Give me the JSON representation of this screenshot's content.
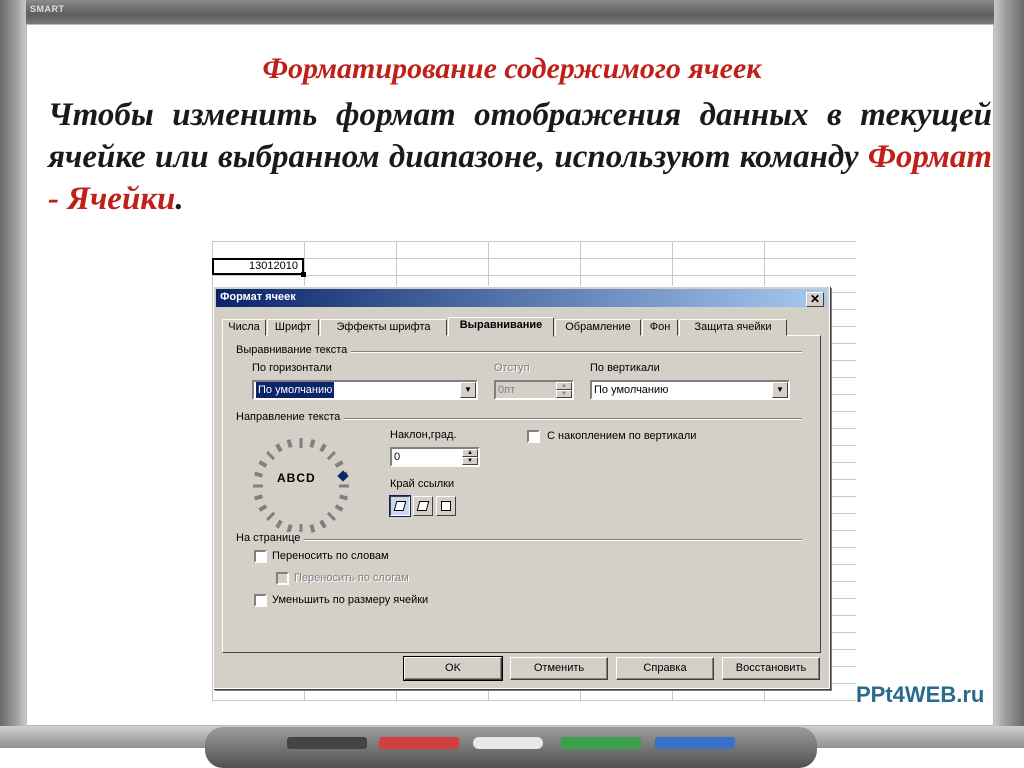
{
  "board": {
    "brand": "SMART",
    "title": "Форматирование содержимого ячеек",
    "para_prefix": "Чтобы изменить формат отображения данных в текущей ячейке или выбранном диапазоне, используют команду ",
    "para_command": "Формат - Ячейки",
    "para_suffix": ".",
    "watermark": "PPt4WEB.ru"
  },
  "sheet": {
    "cell_value": "13012010"
  },
  "dialog": {
    "title": "Формат ячеек",
    "close_glyph": "✕",
    "tabs": [
      "Числа",
      "Шрифт",
      "Эффекты шрифта",
      "Выравнивание",
      "Обрамление",
      "Фон",
      "Защита ячейки"
    ],
    "active_tab": "Выравнивание",
    "text_alignment": {
      "group_label": "Выравнивание текста",
      "horizontal_label": "По горизонтали",
      "horizontal_value": "По умолчанию",
      "indent_label": "Отступ",
      "indent_value": "0пт",
      "vertical_label": "По вертикали",
      "vertical_value": "По умолчанию"
    },
    "text_direction": {
      "group_label": "Направление текста",
      "dial_text": "ABCD",
      "angle_label": "Наклон,град.",
      "angle_value": "0",
      "ref_edge_label": "Край ссылки",
      "stacked_label": "С накоплением по вертикали"
    },
    "on_page": {
      "group_label": "На странице",
      "wrap_words": "Переносить по словам",
      "hyphenate": "Переносить по слогам",
      "shrink": "Уменьшить по размеру ячейки"
    },
    "buttons": {
      "ok": "OK",
      "cancel": "Отменить",
      "help": "Справка",
      "reset": "Восстановить"
    }
  }
}
